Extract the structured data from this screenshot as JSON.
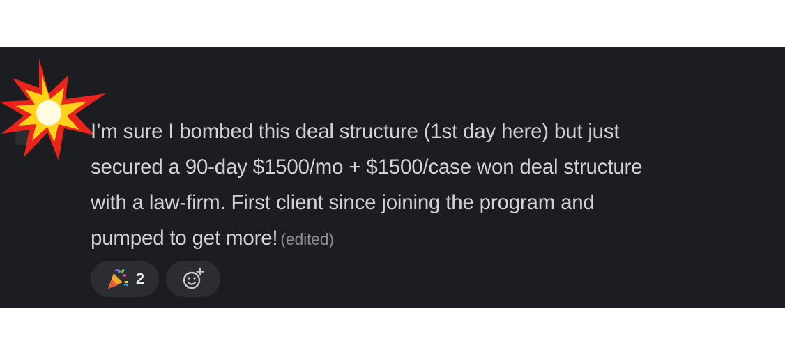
{
  "message": {
    "lines": [
      "I’m sure I bombed this deal structure (1st day here) but just",
      "secured a 90-day $1500/mo + $1500/case won deal structure",
      "with a law-firm. First client since joining the program and",
      "pumped to get more!"
    ],
    "edited_label": "(edited)"
  },
  "reactions": [
    {
      "icon": "party-popper-icon",
      "count": "2"
    }
  ],
  "add_reaction": {
    "icon": "add-reaction-icon"
  },
  "decoration": {
    "icon": "explosion-burst-icon"
  },
  "colors": {
    "panel_bg": "#1b1d21",
    "text": "#d1d2d3",
    "muted": "#8a8c90",
    "pill_bg": "#2b2d31"
  }
}
